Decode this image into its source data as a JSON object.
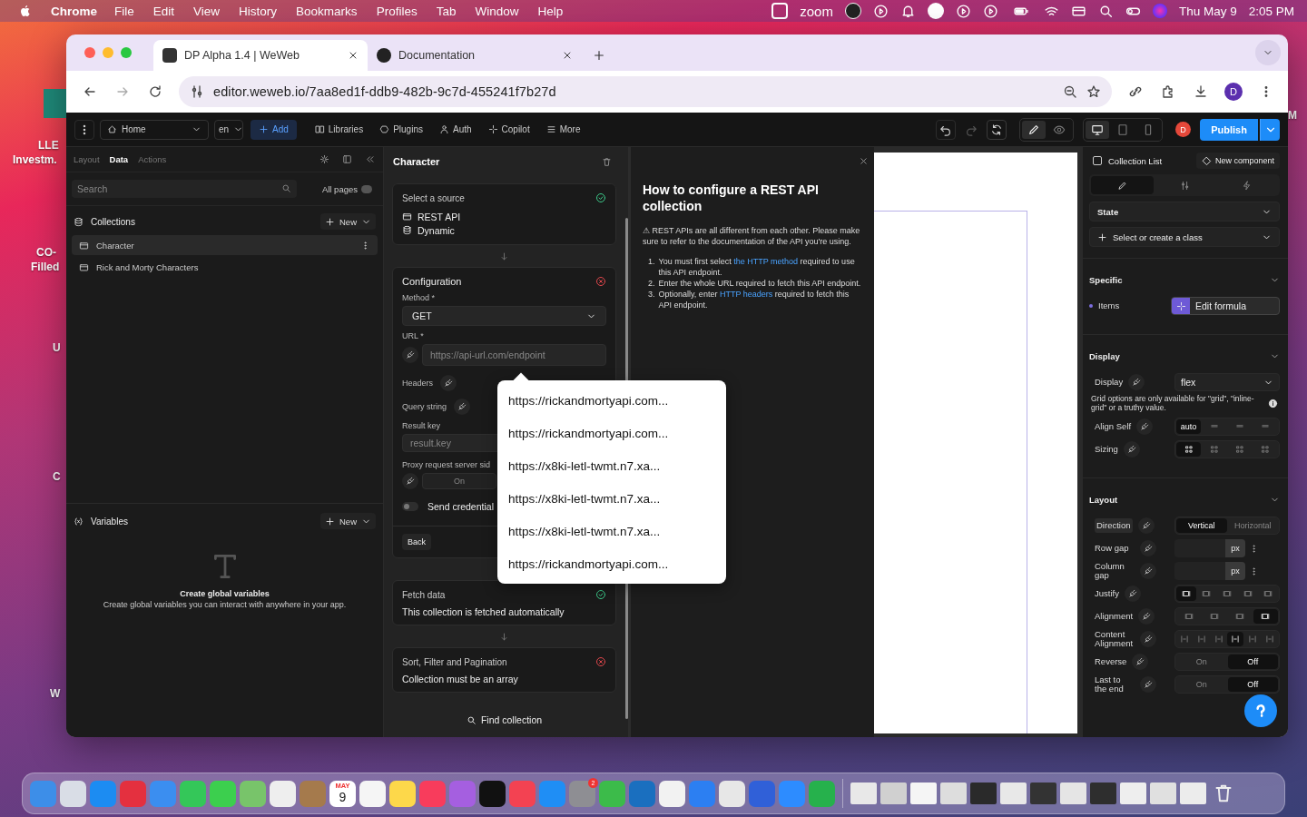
{
  "menubar": {
    "app": "Chrome",
    "menus": [
      "File",
      "Edit",
      "View",
      "History",
      "Bookmarks",
      "Profiles",
      "Tab",
      "Window",
      "Help"
    ],
    "zoom_label": "zoom",
    "date": "Thu May 9",
    "time": "2:05 PM"
  },
  "desktop_labels": [
    {
      "text": "LLE"
    },
    {
      "text": "Investm."
    },
    {
      "text": "CO-"
    },
    {
      "text": "Filled"
    },
    {
      "text": "U"
    },
    {
      "text": "C"
    },
    {
      "text": "W"
    },
    {
      "text": "M"
    }
  ],
  "browser": {
    "tabs": [
      {
        "title": "DP Alpha 1.4 | WeWeb",
        "selected": true
      },
      {
        "title": "Documentation",
        "selected": false
      }
    ],
    "url": "editor.weweb.io/7aa8ed1f-ddb9-482b-9c7d-455241f7b27d",
    "profile": "D"
  },
  "toolbar": {
    "page": "Home",
    "lang": "en",
    "add": "Add",
    "items": [
      {
        "label": "Libraries",
        "kind": "libraries"
      },
      {
        "label": "Plugins",
        "kind": "plugins"
      },
      {
        "label": "Auth",
        "kind": "auth"
      },
      {
        "label": "Copilot",
        "kind": "copilot"
      },
      {
        "label": "More",
        "kind": "more"
      }
    ],
    "edit_modes": [
      {
        "kind": "edit",
        "selected": true
      },
      {
        "kind": "preview",
        "selected": false
      }
    ],
    "devices": [
      {
        "kind": "desktop",
        "selected": true
      },
      {
        "kind": "tablet",
        "selected": false
      },
      {
        "kind": "mobile",
        "selected": false
      }
    ],
    "avatar": "D",
    "publish": "Publish"
  },
  "left_panel": {
    "tabs": [
      {
        "label": "Layout",
        "selected": false
      },
      {
        "label": "Data",
        "selected": true
      },
      {
        "label": "Actions",
        "selected": false
      }
    ],
    "search_placeholder": "Search",
    "all_pages": "All pages",
    "collections_title": "Collections",
    "new_label": "New",
    "collections": [
      {
        "name": "Character",
        "selected": true
      },
      {
        "name": "Rick and Morty Characters",
        "selected": false
      }
    ],
    "variables_title": "Variables",
    "variables_new": "New",
    "empty_title": "Create global variables",
    "empty_text": "Create global variables you can interact with anywhere in your app."
  },
  "collection_panel": {
    "title": "Character",
    "source": {
      "title": "Select a source",
      "complete": true,
      "items": [
        {
          "kind": "api",
          "label": "REST API"
        },
        {
          "kind": "database",
          "label": "Dynamic"
        }
      ]
    },
    "config": {
      "title": "Configuration",
      "complete": false,
      "method_label": "Method *",
      "method": "GET",
      "url_label": "URL *",
      "url_placeholder": "https://api-url.com/endpoint",
      "headers_label": "Headers",
      "query_label": "Query string",
      "result_key_label": "Result key",
      "result_key_placeholder": "result.key",
      "proxy_label": "Proxy request server sid",
      "proxy_option": "On",
      "send_credentials": "Send credential",
      "send_credentials_on": false,
      "back": "Back"
    },
    "fetch": {
      "title": "Fetch data",
      "complete": true,
      "text": "This collection is fetched automatically"
    },
    "sort": {
      "title": "Sort, Filter and Pagination",
      "complete": false,
      "text": "Collection must be an array"
    },
    "find": "Find collection"
  },
  "url_suggestions": [
    "https://rickandmortyapi.com...",
    "https://rickandmortyapi.com...",
    "https://x8ki-letl-twmt.n7.xa...",
    "https://x8ki-letl-twmt.n7.xa...",
    "https://x8ki-letl-twmt.n7.xa...",
    "https://rickandmortyapi.com..."
  ],
  "docs": {
    "title": "How to configure a REST API collection",
    "warning": "⚠ REST APIs are all different from each other. Please make sure to refer to the documentation of the API you're using.",
    "steps": [
      {
        "marker": "1.",
        "before": "You must first select ",
        "link": "the HTTP method",
        "after": " required to use this API endpoint."
      },
      {
        "marker": "2.",
        "before": "Enter the whole URL required to fetch this API endpoint."
      },
      {
        "marker": "3.",
        "before": "Optionally, enter ",
        "link": "HTTP headers",
        "after": " required to fetch this API endpoint."
      }
    ]
  },
  "right_panel": {
    "element": "Collection List",
    "new_component": "New component",
    "modes": [
      {
        "kind": "style",
        "selected": true
      },
      {
        "kind": "settings",
        "selected": false
      },
      {
        "kind": "workflows",
        "selected": false
      }
    ],
    "state": "State",
    "class_select": "Select or create a class",
    "specific_title": "Specific",
    "items_label": "Items",
    "formula": "Edit formula",
    "display_title": "Display",
    "display_label": "Display",
    "display_value": "flex",
    "grid_note": "Grid options are only available for \"grid\", \"inline-grid\" or a truthy value.",
    "align_self_label": "Align Self",
    "align_self_value": "auto",
    "align_self": [
      {
        "selected": true
      },
      {
        "selected": false
      },
      {
        "selected": false
      },
      {
        "selected": false
      }
    ],
    "sizing_label": "Sizing",
    "sizing": [
      {
        "selected": true
      },
      {
        "selected": false
      },
      {
        "selected": false
      },
      {
        "selected": false
      }
    ],
    "layout_title": "Layout",
    "direction_label": "Direction",
    "direction": [
      {
        "label": "Vertical",
        "selected": true
      },
      {
        "label": "Horizontal",
        "selected": false
      }
    ],
    "row_gap_label": "Row gap",
    "row_gap_unit": "px",
    "column_gap_label": "Column gap",
    "column_gap_unit": "px",
    "justify_label": "Justify",
    "justify": [
      {
        "selected": true
      },
      {
        "selected": false
      },
      {
        "selected": false
      },
      {
        "selected": false
      },
      {
        "selected": false
      }
    ],
    "alignment_label": "Alignment",
    "alignment": [
      {
        "selected": false
      },
      {
        "selected": false
      },
      {
        "selected": false
      },
      {
        "selected": true
      }
    ],
    "content_alignment_label": "Content Alignment",
    "content_alignment": [
      {
        "selected": false
      },
      {
        "selected": false
      },
      {
        "selected": false
      },
      {
        "selected": true
      },
      {
        "selected": false
      },
      {
        "selected": false
      }
    ],
    "reverse_label": "Reverse",
    "reverse": [
      {
        "label": "On",
        "selected": false
      },
      {
        "label": "Off",
        "selected": true
      }
    ],
    "last_label": "Last to the end",
    "last": [
      {
        "label": "On",
        "selected": false
      },
      {
        "label": "Off",
        "selected": true
      }
    ]
  },
  "dock": {
    "apps": [
      {
        "color": "#3d8ee8"
      },
      {
        "color": "#d9dde6"
      },
      {
        "color": "#1c8cf2"
      },
      {
        "color": "#e4303f"
      },
      {
        "color": "#3b8ef0"
      },
      {
        "color": "#34c759"
      },
      {
        "color": "#3ccf4e"
      },
      {
        "color": "#78c46a"
      },
      {
        "color": "#eeeeee"
      },
      {
        "color": "#a57a4c"
      },
      {
        "color": "#ffffff",
        "kind": "calendar",
        "month": "MAY",
        "day": "9"
      },
      {
        "color": "#f5f5f5"
      },
      {
        "color": "#fdd84a"
      },
      {
        "color": "#f83c5c"
      },
      {
        "color": "#a55fe0"
      },
      {
        "color": "#111111"
      },
      {
        "color": "#f34252"
      },
      {
        "color": "#1f8ef5"
      },
      {
        "color": "#8e8e93",
        "badge": "2"
      },
      {
        "color": "#3cbb4a"
      },
      {
        "color": "#1a6fbf"
      },
      {
        "color": "#f2f2f2"
      },
      {
        "color": "#2c7ff2"
      },
      {
        "color": "#e7e7e7"
      },
      {
        "color": "#3060d8"
      },
      {
        "color": "#2d8cff"
      },
      {
        "color": "#26b14c"
      }
    ],
    "recent": [
      {
        "color": "#e8e8e8"
      },
      {
        "color": "#d0d0d0"
      },
      {
        "color": "#f5f5f5"
      },
      {
        "color": "#dddddd"
      },
      {
        "color": "#2a2a2a"
      },
      {
        "color": "#e8e8e8"
      },
      {
        "color": "#333333"
      },
      {
        "color": "#e5e5e5"
      },
      {
        "color": "#2e2e2e"
      },
      {
        "color": "#eeeeee"
      },
      {
        "color": "#e0e0e0"
      },
      {
        "color": "#ececec"
      }
    ]
  }
}
